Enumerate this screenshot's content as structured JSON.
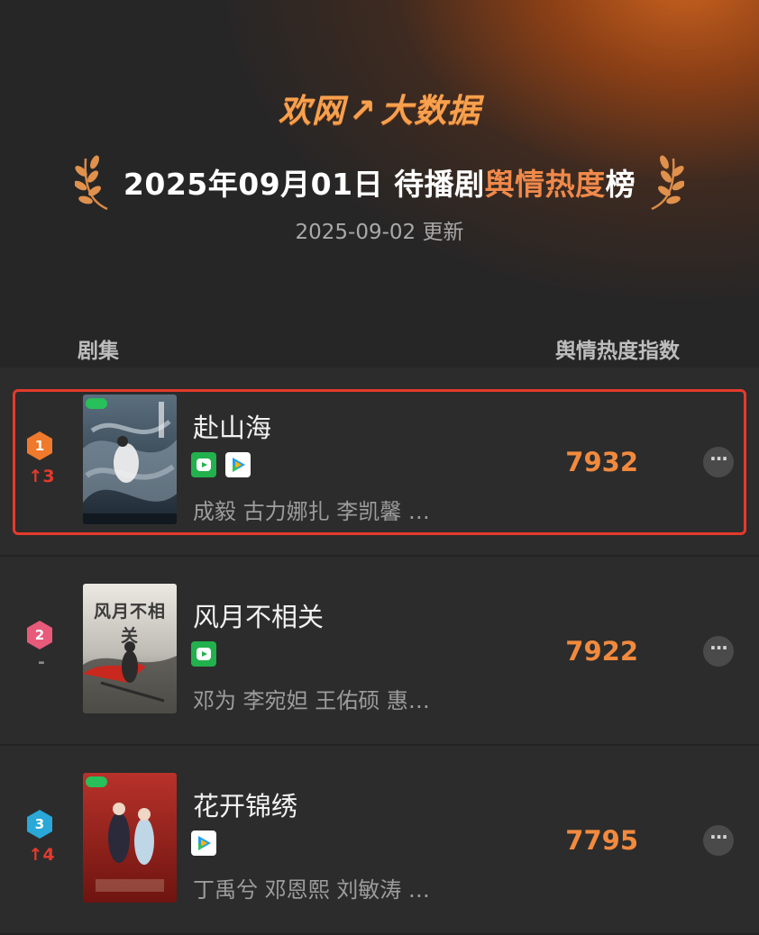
{
  "header": {
    "brand_left": "欢网",
    "brand_arrow": "↗",
    "brand_right": "大数据",
    "title_prefix": "2025年09月01日 待播剧",
    "title_highlight": "舆情热度",
    "title_suffix": "榜",
    "updated": "2025-09-02 更新"
  },
  "columns": {
    "left": "剧集",
    "right": "舆情热度指数"
  },
  "colors": {
    "accent": "#f28a3e",
    "highlight_frame": "#e53a2c",
    "rank1": "#f07a2c",
    "rank2": "#e85a7a",
    "rank3": "#2aa8d8",
    "rise": "#e53a2c"
  },
  "rows": [
    {
      "rank": "1",
      "change": "↑3",
      "name": "赴山海",
      "platforms": [
        "iqiyi-icon",
        "tencent-video-icon"
      ],
      "cast": "成毅 古力娜扎 李凯馨 …",
      "score": "7932",
      "highlighted": true
    },
    {
      "rank": "2",
      "change": "-",
      "name": "风月不相关",
      "poster_title": "风月不相关",
      "platforms": [
        "iqiyi-icon"
      ],
      "cast": "邓为 李宛妲 王佑硕 惠…",
      "score": "7922",
      "highlighted": false
    },
    {
      "rank": "3",
      "change": "↑4",
      "name": "花开锦绣",
      "platforms": [
        "tencent-video-icon"
      ],
      "cast": "丁禹兮 邓恩熙 刘敏涛 …",
      "score": "7795",
      "highlighted": false
    }
  ],
  "more_label": "···"
}
